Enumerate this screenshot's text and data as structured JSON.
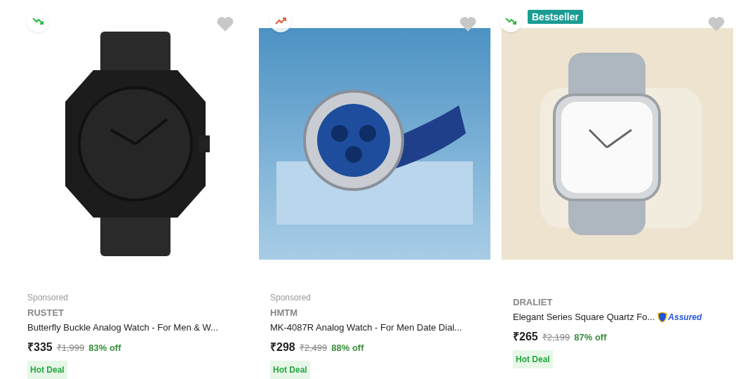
{
  "products": [
    {
      "trending_up": false,
      "favorite": false,
      "sponsored": "Sponsored",
      "brand": "RUSTET",
      "title": "Butterfly Buckle Analog Watch - For Men & W...",
      "price": "₹335",
      "mrp": "₹1,999",
      "discount": "83% off",
      "deal": "Hot Deal"
    },
    {
      "trending_up": true,
      "favorite": false,
      "sponsored": "Sponsored",
      "brand": "HMTM",
      "title": "MK-4087R Analog Watch - For Men Date Dial...",
      "price": "₹298",
      "mrp": "₹2,499",
      "discount": "88% off",
      "deal": "Hot Deal"
    },
    {
      "trending_up": false,
      "favorite": false,
      "badge": "Bestseller",
      "brand": "DRALIET",
      "title": "Elegant Series Square Quartz Fo...",
      "assured": "Assured",
      "price": "₹265",
      "mrp": "₹2,199",
      "discount": "87% off",
      "deal": "Hot Deal"
    }
  ]
}
